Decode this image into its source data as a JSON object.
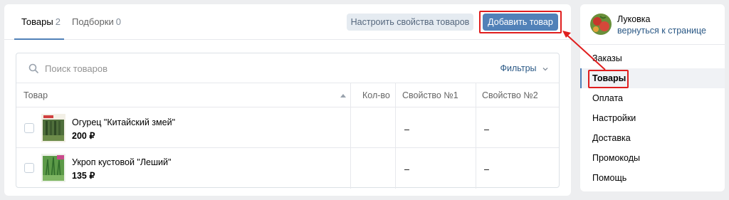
{
  "tabs": [
    {
      "label": "Товары",
      "count": "2",
      "active": true
    },
    {
      "label": "Подборки",
      "count": "0",
      "active": false
    }
  ],
  "toolbar": {
    "configure_label": "Настроить свойства товаров",
    "add_label": "Добавить товар"
  },
  "search": {
    "placeholder": "Поиск товаров",
    "filters_label": "Фильтры"
  },
  "table": {
    "columns": [
      "Товар",
      "Кол-во",
      "Свойство №1",
      "Свойство №2"
    ],
    "rows": [
      {
        "name": "Огурец \"Китайский змей\"",
        "price": "200 ₽",
        "qty": "",
        "prop1": "–",
        "prop2": "–"
      },
      {
        "name": "Укроп кустовой \"Леший\"",
        "price": "135 ₽",
        "qty": "",
        "prop1": "–",
        "prop2": "–"
      }
    ]
  },
  "sidebar": {
    "community_name": "Луковка",
    "back_link": "вернуться к странице",
    "items": [
      {
        "label": "Заказы",
        "active": false
      },
      {
        "label": "Товары",
        "active": true
      },
      {
        "label": "Оплата",
        "active": false
      },
      {
        "label": "Настройки",
        "active": false
      },
      {
        "label": "Доставка",
        "active": false
      },
      {
        "label": "Промокоды",
        "active": false
      },
      {
        "label": "Помощь",
        "active": false
      }
    ]
  },
  "colors": {
    "accent": "#5181b8",
    "highlight": "#e01e1e",
    "link": "#2a5885"
  },
  "icons": {
    "search": "search-icon",
    "filters": "chevron-down-icon",
    "sort": "sort-up-icon",
    "annotation": "arrow-icon"
  }
}
